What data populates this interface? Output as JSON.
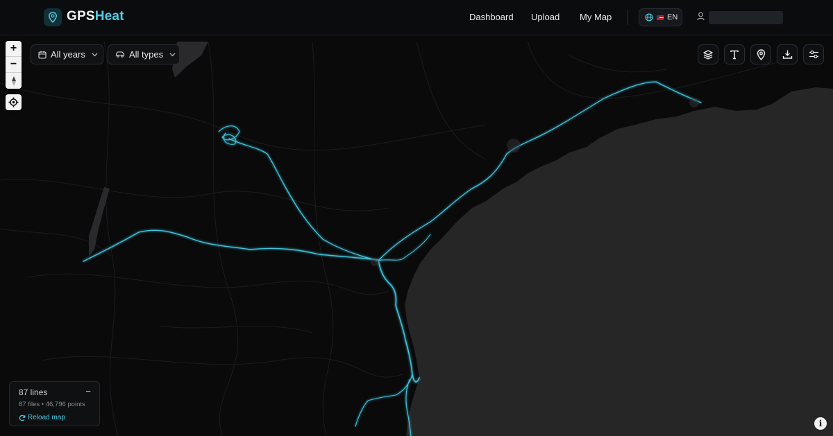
{
  "header": {
    "logo_gps": "GPS",
    "logo_heat": "Heat",
    "nav": [
      {
        "label": "Dashboard"
      },
      {
        "label": "Upload"
      },
      {
        "label": "My Map"
      }
    ],
    "language": "EN",
    "language_icon": "globe-icon",
    "flag": "us-flag",
    "user_icon": "user-icon"
  },
  "filters": {
    "years_label": "All years",
    "types_label": "All types",
    "years_icon": "calendar-icon",
    "types_icon": "car-icon"
  },
  "map_controls": {
    "zoom_in": "+",
    "zoom_out": "−",
    "compass_icon": "compass-icon",
    "locate_icon": "locate-icon"
  },
  "tools": [
    "layers-icon",
    "text-icon",
    "pin-icon",
    "download-icon",
    "sliders-icon"
  ],
  "stats": {
    "lines": "87 lines",
    "collapse": "−",
    "summary": "87 files • 46,796 points",
    "reload_label": "Reload map"
  },
  "info_label": "i",
  "colors": {
    "accent": "#4fd1e6",
    "land": "#0a0a0b",
    "sea": "#262626",
    "track": "#3fc4dc"
  }
}
